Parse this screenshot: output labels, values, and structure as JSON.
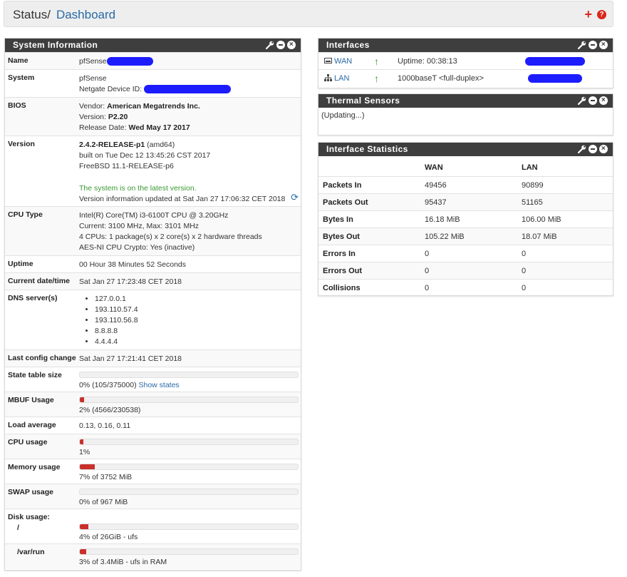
{
  "header": {
    "title": "Status",
    "breadcrumb": "Dashboard",
    "add_label": "+",
    "help_label": "?"
  },
  "sysinfo": {
    "title": "System Information",
    "name_label": "Name",
    "name_value": "pfSense",
    "system_label": "System",
    "system_value": "pfSense",
    "device_id_label": "Netgate Device ID:",
    "bios_label": "BIOS",
    "bios_vendor_label": "Vendor:",
    "bios_vendor": "American Megatrends Inc.",
    "bios_version_label": "Version:",
    "bios_version": "P2.20",
    "bios_date_label": "Release Date:",
    "bios_date": "Wed May 17 2017",
    "version_label": "Version",
    "version_main": "2.4.2-RELEASE-p1",
    "version_arch": "(amd64)",
    "version_built": "built on Tue Dec 12 13:45:26 CST 2017",
    "version_os": "FreeBSD 11.1-RELEASE-p6",
    "version_status": "The system is on the latest version.",
    "version_updated": "Version information updated at Sat Jan 27 17:06:32 CET 2018",
    "cpu_label": "CPU Type",
    "cpu_model": "Intel(R) Core(TM) i3-6100T CPU @ 3.20GHz",
    "cpu_freq": "Current: 3100 MHz, Max: 3101 MHz",
    "cpu_cores": "4 CPUs: 1 package(s) x 2 core(s) x 2 hardware threads",
    "cpu_crypto": "AES-NI CPU Crypto: Yes (inactive)",
    "uptime_label": "Uptime",
    "uptime_value": "00 Hour 38 Minutes 52 Seconds",
    "datetime_label": "Current date/time",
    "datetime_value": "Sat Jan 27 17:23:48 CET 2018",
    "dns_label": "DNS server(s)",
    "dns_servers": [
      "127.0.0.1",
      "193.110.57.4",
      "193.110.56.8",
      "8.8.8.8",
      "4.4.4.4"
    ],
    "lastconfig_label": "Last config change",
    "lastconfig_value": "Sat Jan 27 17:21:41 CET 2018",
    "state_label": "State table size",
    "state_text": "0% (105/375000)",
    "state_link": "Show states",
    "state_pct": 0,
    "mbuf_label": "MBUF Usage",
    "mbuf_text": "2% (4566/230538)",
    "mbuf_pct": 2,
    "load_label": "Load average",
    "load_value": "0.13, 0.16, 0.11",
    "cpu_usage_label": "CPU usage",
    "cpu_usage_text": "1%",
    "cpu_usage_pct": 1,
    "memory_label": "Memory usage",
    "memory_text": "7% of 3752 MiB",
    "memory_pct": 7,
    "swap_label": "SWAP usage",
    "swap_text": "0% of 967 MiB",
    "swap_pct": 0,
    "disk_label": "Disk usage:",
    "disk_root_label": "/",
    "disk_root_text": "4% of 26GiB - ufs",
    "disk_root_pct": 4,
    "disk_varrun_label": "/var/run",
    "disk_varrun_text": "3% of 3.4MiB - ufs in RAM",
    "disk_varrun_pct": 3
  },
  "interfaces": {
    "title": "Interfaces",
    "rows": [
      {
        "name": "WAN",
        "icon": "ethernet-icon",
        "status": "Uptime: 00:38:13"
      },
      {
        "name": "LAN",
        "icon": "network-icon",
        "status": "1000baseT <full-duplex>"
      }
    ]
  },
  "thermal": {
    "title": "Thermal Sensors",
    "status": "(Updating...)"
  },
  "ifstats": {
    "title": "Interface Statistics",
    "columns": [
      "WAN",
      "LAN"
    ],
    "rows": [
      {
        "label": "Packets In",
        "wan": "49456",
        "lan": "90899"
      },
      {
        "label": "Packets Out",
        "wan": "95437",
        "lan": "51165"
      },
      {
        "label": "Bytes In",
        "wan": "16.18 MiB",
        "lan": "106.00 MiB"
      },
      {
        "label": "Bytes Out",
        "wan": "105.22 MiB",
        "lan": "18.07 MiB"
      },
      {
        "label": "Errors In",
        "wan": "0",
        "lan": "0"
      },
      {
        "label": "Errors Out",
        "wan": "0",
        "lan": "0"
      },
      {
        "label": "Collisions",
        "wan": "0",
        "lan": "0"
      }
    ]
  }
}
